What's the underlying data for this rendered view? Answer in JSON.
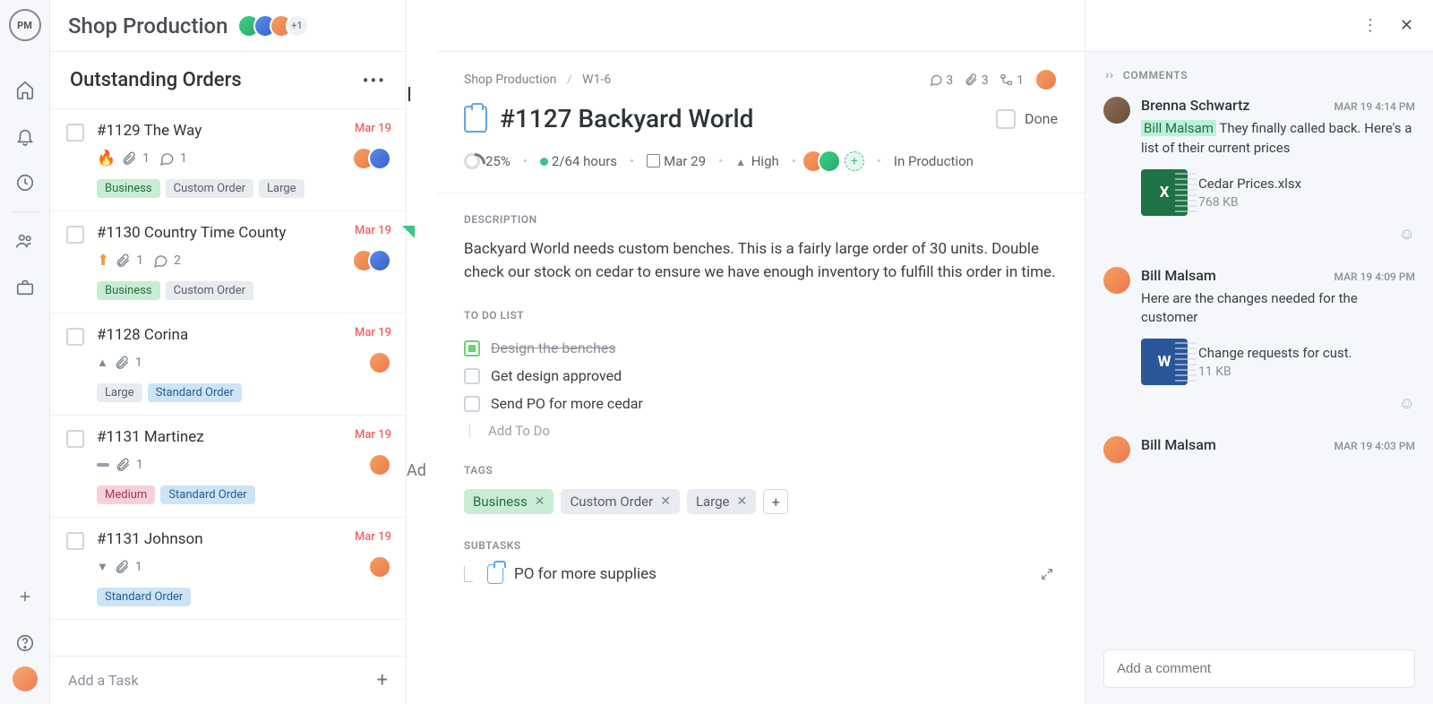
{
  "project": {
    "title": "Shop Production",
    "avatar_more": "+1"
  },
  "outstanding": {
    "title": "Outstanding Orders",
    "peek_col_letter": "I",
    "peek_add": "Ad",
    "add_task": "Add a Task",
    "tasks": [
      {
        "name": "#1129 The Way",
        "date": "Mar 19",
        "priority": "critical",
        "attach": "1",
        "comments": "1",
        "tags": [
          "Business",
          "Custom Order",
          "Large"
        ],
        "tag_styles": [
          "green",
          "gray",
          "gray"
        ],
        "avatars": 2
      },
      {
        "name": "#1130 Country Time County",
        "date": "Mar 19",
        "priority": "up-orange",
        "attach": "1",
        "comments": "2",
        "tags": [
          "Business",
          "Custom Order"
        ],
        "tag_styles": [
          "green",
          "gray"
        ],
        "avatars": 2
      },
      {
        "name": "#1128 Corina",
        "date": "Mar 19",
        "priority": "high",
        "attach": "1",
        "comments": "",
        "tags": [
          "Large",
          "Standard Order"
        ],
        "tag_styles": [
          "gray",
          "blue"
        ],
        "avatars": 1
      },
      {
        "name": "#1131 Martinez",
        "date": "Mar 19",
        "priority": "med",
        "attach": "1",
        "comments": "",
        "tags": [
          "Medium",
          "Standard Order"
        ],
        "tag_styles": [
          "pink",
          "blue"
        ],
        "avatars": 1
      },
      {
        "name": "#1131 Johnson",
        "date": "Mar 19",
        "priority": "low",
        "attach": "1",
        "comments": "",
        "tags": [
          "Standard Order"
        ],
        "tag_styles": [
          "blue"
        ],
        "avatars": 1
      }
    ]
  },
  "detail": {
    "crumb_project": "Shop Production",
    "crumb_item": "W1-6",
    "counts": {
      "comments": "3",
      "attachments": "3",
      "subtasks": "1"
    },
    "title": "#1127 Backyard World",
    "done_label": "Done",
    "progress": "25%",
    "hours": "2/64 hours",
    "due": "Mar 29",
    "priority": "High",
    "status": "In Production",
    "description_label": "DESCRIPTION",
    "description": "Backyard World needs custom benches. This is a fairly large order of 30 units. Double check our stock on cedar to ensure we have enough inventory to fulfill this order in time.",
    "todo_label": "TO DO LIST",
    "todos": [
      {
        "text": "Design the benches",
        "done": true
      },
      {
        "text": "Get design approved",
        "done": false
      },
      {
        "text": "Send PO for more cedar",
        "done": false
      }
    ],
    "add_todo": "Add To Do",
    "tags_label": "TAGS",
    "tags": [
      {
        "text": "Business",
        "style": "green"
      },
      {
        "text": "Custom Order",
        "style": "gray"
      },
      {
        "text": "Large",
        "style": "gray"
      }
    ],
    "subtasks_label": "SUBTASKS",
    "subtask1": "PO for more supplies"
  },
  "comments": {
    "header": "COMMENTS",
    "input_placeholder": "Add a comment",
    "items": [
      {
        "author": "Brenna Schwartz",
        "time": "MAR 19 4:14 PM",
        "mention": "Bill Malsam",
        "text": " They finally called back. Here's a list of their current prices",
        "file": {
          "type": "xl",
          "letter": "X",
          "name": "Cedar Prices.xlsx",
          "size": "768 KB"
        }
      },
      {
        "author": "Bill Malsam",
        "time": "MAR 19 4:09 PM",
        "mention": "",
        "text": "Here are the changes needed for the customer",
        "file": {
          "type": "wd",
          "letter": "W",
          "name": "Change requests for cust.",
          "size": "11 KB"
        }
      },
      {
        "author": "Bill Malsam",
        "time": "MAR 19 4:03 PM",
        "mention": "",
        "text": "",
        "file": null
      }
    ]
  }
}
